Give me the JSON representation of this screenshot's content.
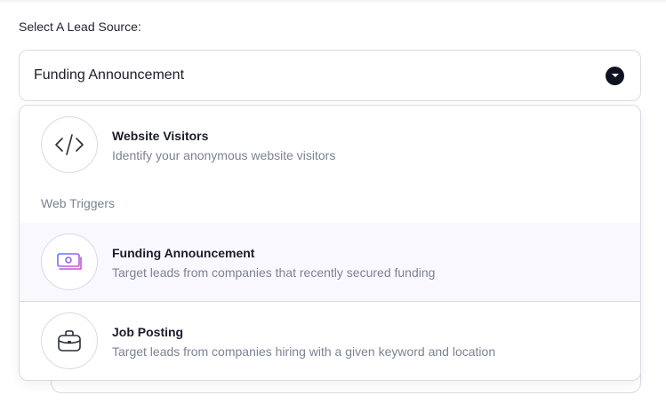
{
  "field": {
    "label": "Select A Lead Source:",
    "selected_value": "Funding Announcement"
  },
  "dropdown": {
    "options": [
      {
        "title": "Website Visitors",
        "description": "Identify your anonymous website visitors",
        "icon": "code-icon"
      },
      {
        "title": "Funding Announcement",
        "description": "Target leads from companies that recently secured funding",
        "icon": "money-icon"
      },
      {
        "title": "Job Posting",
        "description": "Target leads from companies hiring with a given keyword and location",
        "icon": "briefcase-icon"
      }
    ],
    "group_header": "Web Triggers"
  },
  "colors": {
    "accent_start": "#4f7cff",
    "accent_end": "#e24bd8",
    "highlight_bg": "#faf8ff",
    "border": "#d8dbe2",
    "muted_text": "#7b8294"
  }
}
